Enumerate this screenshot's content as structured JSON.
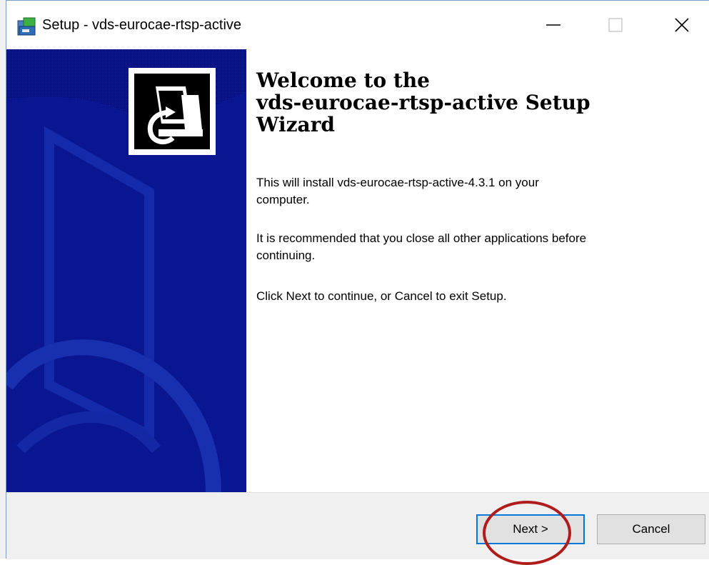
{
  "window": {
    "title": "Setup - vds-eurocae-rtsp-active",
    "controls": {
      "minimize": "—",
      "maximize": "☐",
      "close": "✕"
    }
  },
  "sidebar": {
    "icon": "installer-computer-icon",
    "background_color": "#000c80"
  },
  "content": {
    "heading": "Welcome to the\nvds-eurocae-rtsp-active Setup\nWizard",
    "paragraphs": [
      "This will install vds-eurocae-rtsp-active-4.3.1 on your\ncomputer.",
      "It is recommended that you close all other applications before\ncontinuing.",
      "Click Next to continue, or Cancel to exit Setup."
    ]
  },
  "buttons": {
    "next_label": "Next >",
    "cancel_label": "Cancel"
  },
  "annotation": {
    "color": "#b01b1b"
  }
}
